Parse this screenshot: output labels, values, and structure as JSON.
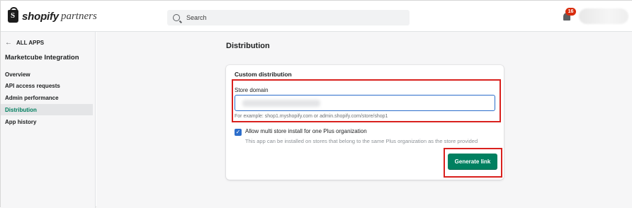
{
  "header": {
    "logo_wordmark": "shopify",
    "logo_subtitle": "partners",
    "search_placeholder": "Search",
    "notifications_count": "16",
    "icons": {
      "search": "search-icon",
      "notifications": "bell-icon",
      "logo": "shopify-bag-icon"
    }
  },
  "sidebar": {
    "back_label": "ALL APPS",
    "back_icon": "arrow-left-icon",
    "app_name": "Marketcube Integration",
    "items": [
      {
        "label": "Overview",
        "active": false
      },
      {
        "label": "API access requests",
        "active": false
      },
      {
        "label": "Admin performance",
        "active": false
      },
      {
        "label": "Distribution",
        "active": true
      },
      {
        "label": "App history",
        "active": false
      }
    ]
  },
  "main": {
    "page_title": "Distribution",
    "card": {
      "title": "Custom distribution",
      "store_domain_label": "Store domain",
      "store_domain_help": "For example: shop1.myshopify.com or admin.shopify.com/store/shop1",
      "plus_checkbox": {
        "checked": true,
        "label": "Allow multi store install for one Plus organization",
        "help": "This app can be installed on stores that belong to the same Plus organization as the store provided"
      },
      "generate_button_label": "Generate link"
    }
  },
  "colors": {
    "primary_button": "#008060",
    "active_nav_text": "#007f5f",
    "highlight_box": "#d9211e",
    "notification_badge": "#d82c0d",
    "checkbox": "#2c6ecb"
  }
}
